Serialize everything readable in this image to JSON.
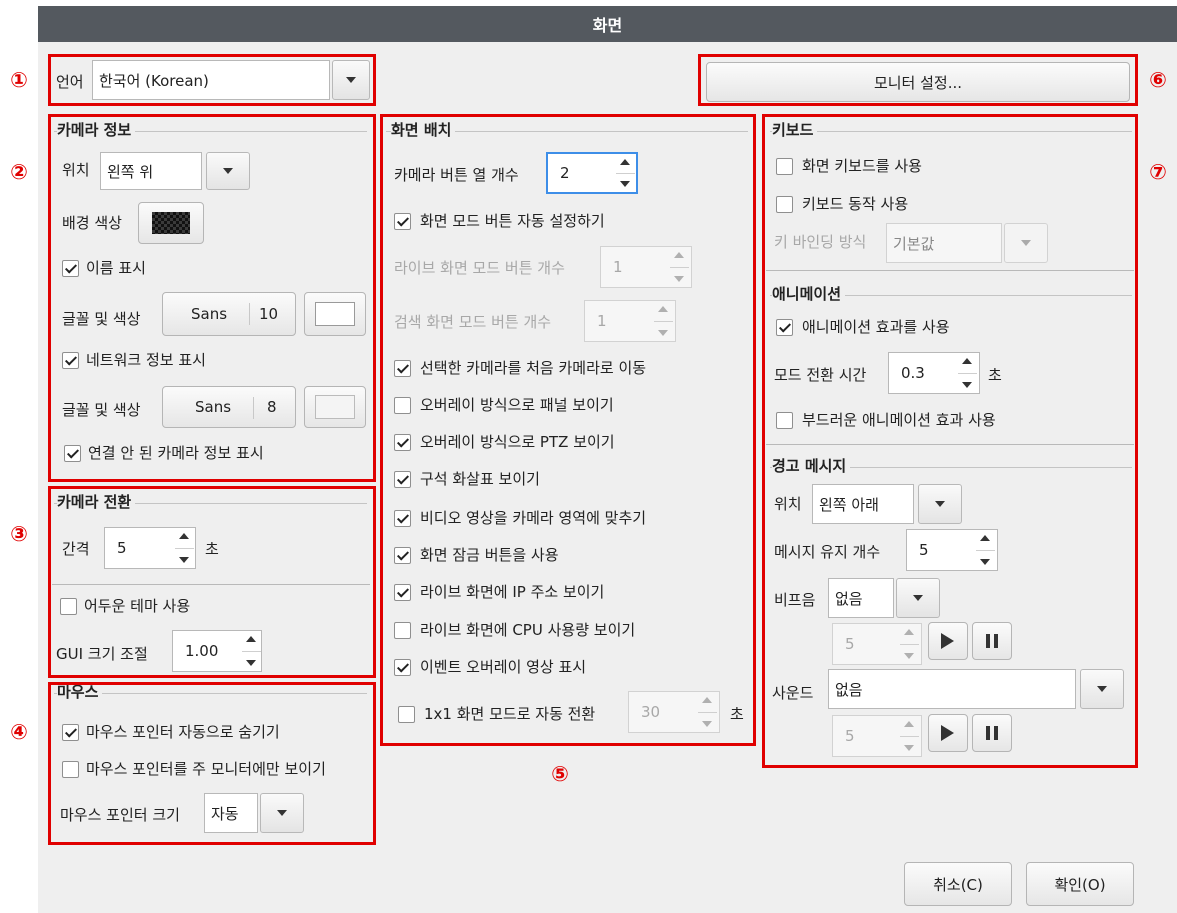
{
  "window": {
    "title": "화면"
  },
  "markers": [
    "①",
    "②",
    "③",
    "④",
    "⑤",
    "⑥",
    "⑦"
  ],
  "language": {
    "label": "언어",
    "value": "한국어 (Korean)"
  },
  "monitor_button": "모니터 설정...",
  "camera_info": {
    "title": "카메라 정보",
    "position_label": "위치",
    "position_value": "왼쪽 위",
    "bg_color_label": "배경 색상",
    "show_name": {
      "label": "이름 표시",
      "checked": true
    },
    "font_label_1": "글꼴 및 색상",
    "font_name_1": "Sans",
    "font_size_1": "10",
    "show_network": {
      "label": "네트워크 정보 표시",
      "checked": true
    },
    "font_label_2": "글꼴 및 색상",
    "font_name_2": "Sans",
    "font_size_2": "8",
    "show_disconnected": {
      "label": "연결 안 된 카메라 정보 표시",
      "checked": true
    }
  },
  "camera_switch": {
    "title": "카메라 전환",
    "interval_label": "간격",
    "interval_value": "5",
    "interval_unit": "초",
    "dark_theme": {
      "label": "어두운 테마 사용",
      "checked": false
    },
    "gui_scale_label": "GUI 크기 조절",
    "gui_scale_value": "1.00"
  },
  "mouse": {
    "title": "마우스",
    "auto_hide": {
      "label": "마우스 포인터 자동으로 숨기기",
      "checked": true
    },
    "main_monitor_only": {
      "label": "마우스 포인터를 주 모니터에만 보이기",
      "checked": false
    },
    "pointer_size_label": "마우스 포인터 크기",
    "pointer_size_value": "자동"
  },
  "layout": {
    "title": "화면 배치",
    "columns_label": "카메라 버튼 열 개수",
    "columns_value": "2",
    "auto_mode_buttons": {
      "label": "화면 모드 버튼 자동 설정하기",
      "checked": true
    },
    "live_mode_buttons_label": "라이브 화면 모드 버튼 개수",
    "live_mode_buttons_value": "1",
    "search_mode_buttons_label": "검색 화면 모드 버튼 개수",
    "search_mode_buttons_value": "1",
    "options": [
      {
        "label": "선택한 카메라를 처음 카메라로 이동",
        "checked": true
      },
      {
        "label": "오버레이 방식으로 패널 보이기",
        "checked": false
      },
      {
        "label": "오버레이 방식으로 PTZ 보이기",
        "checked": true
      },
      {
        "label": "구석 화살표 보이기",
        "checked": true
      },
      {
        "label": "비디오 영상을 카메라 영역에 맞추기",
        "checked": true
      },
      {
        "label": "화면 잠금 버튼을 사용",
        "checked": true
      },
      {
        "label": "라이브 화면에 IP 주소 보이기",
        "checked": true
      },
      {
        "label": "라이브 화면에 CPU 사용량 보이기",
        "checked": false
      },
      {
        "label": "이벤트 오버레이 영상 표시",
        "checked": true
      }
    ],
    "auto_1x1": {
      "label": "1x1 화면 모드로 자동 전환",
      "checked": false
    },
    "auto_1x1_value": "30",
    "auto_1x1_unit": "초"
  },
  "keyboard": {
    "title": "키보드",
    "onscreen": {
      "label": "화면 키보드를 사용",
      "checked": false
    },
    "actions": {
      "label": "키보드 동작 사용",
      "checked": false
    },
    "binding_label": "키 바인딩 방식",
    "binding_value": "기본값"
  },
  "animation": {
    "title": "애니메이션",
    "use_effects": {
      "label": "애니메이션 효과를 사용",
      "checked": true
    },
    "switch_time_label": "모드 전환 시간",
    "switch_time_value": "0.3",
    "switch_time_unit": "초",
    "smooth": {
      "label": "부드러운 애니메이션 효과 사용",
      "checked": false
    }
  },
  "warning": {
    "title": "경고 메시지",
    "position_label": "위치",
    "position_value": "왼쪽 아래",
    "keep_count_label": "메시지 유지 개수",
    "keep_count_value": "5",
    "beep_label": "비프음",
    "beep_value": "없음",
    "beep_repeat": "5",
    "sound_label": "사운드",
    "sound_value": "없음",
    "sound_repeat": "5"
  },
  "buttons": {
    "cancel": "취소(C)",
    "ok": "확인(O)"
  },
  "colors": {
    "highlight": "#e00000",
    "titlebar": "#54595f",
    "focus": "#3d8ee8",
    "camera_bg_swatch": "#2a2a2a"
  }
}
